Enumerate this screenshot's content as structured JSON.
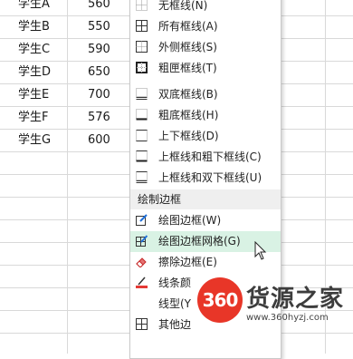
{
  "sheet": {
    "rows": [
      {
        "name": "学生A",
        "score": "560"
      },
      {
        "name": "学生B",
        "score": "550"
      },
      {
        "name": "学生C",
        "score": "590"
      },
      {
        "name": "学生D",
        "score": "650"
      },
      {
        "name": "学生E",
        "score": "700"
      },
      {
        "name": "学生F",
        "score": "576"
      },
      {
        "name": "学生G",
        "score": "600"
      }
    ]
  },
  "menu": {
    "items": [
      {
        "label": "无框线(N)",
        "icon": "no-border-icon"
      },
      {
        "label": "所有框线(A)",
        "icon": "all-borders-icon"
      },
      {
        "label": "外侧框线(S)",
        "icon": "outside-borders-icon"
      },
      {
        "label": "粗匣框线(T)",
        "icon": "thick-box-border-icon"
      },
      {
        "label": "双底框线(B)",
        "icon": "double-bottom-border-icon"
      },
      {
        "label": "粗底框线(H)",
        "icon": "thick-bottom-border-icon"
      },
      {
        "label": "上下框线(D)",
        "icon": "top-bottom-border-icon"
      },
      {
        "label": "上框线和粗下框线(C)",
        "icon": "top-thick-bottom-border-icon"
      },
      {
        "label": "上框线和双下框线(U)",
        "icon": "top-double-bottom-border-icon"
      }
    ],
    "draw_section_label": "绘制边框",
    "draw_items": [
      {
        "label": "绘图边框(W)",
        "icon": "draw-border-icon"
      },
      {
        "label": "绘图边框网格(G)",
        "icon": "draw-border-grid-icon",
        "highlighted": true
      },
      {
        "label": "擦除边框(E)",
        "icon": "eraser-icon"
      },
      {
        "label": "线条颜",
        "icon": "line-color-icon",
        "accent": "#e53935"
      },
      {
        "label": "线型(Y",
        "icon": "line-style-icon"
      },
      {
        "label": "其他边",
        "icon": "more-borders-icon"
      }
    ]
  },
  "watermark": {
    "logo_text": "360",
    "title": "货源之家",
    "url": "www.360hyzj.com",
    "logo_color": "#e83628"
  }
}
